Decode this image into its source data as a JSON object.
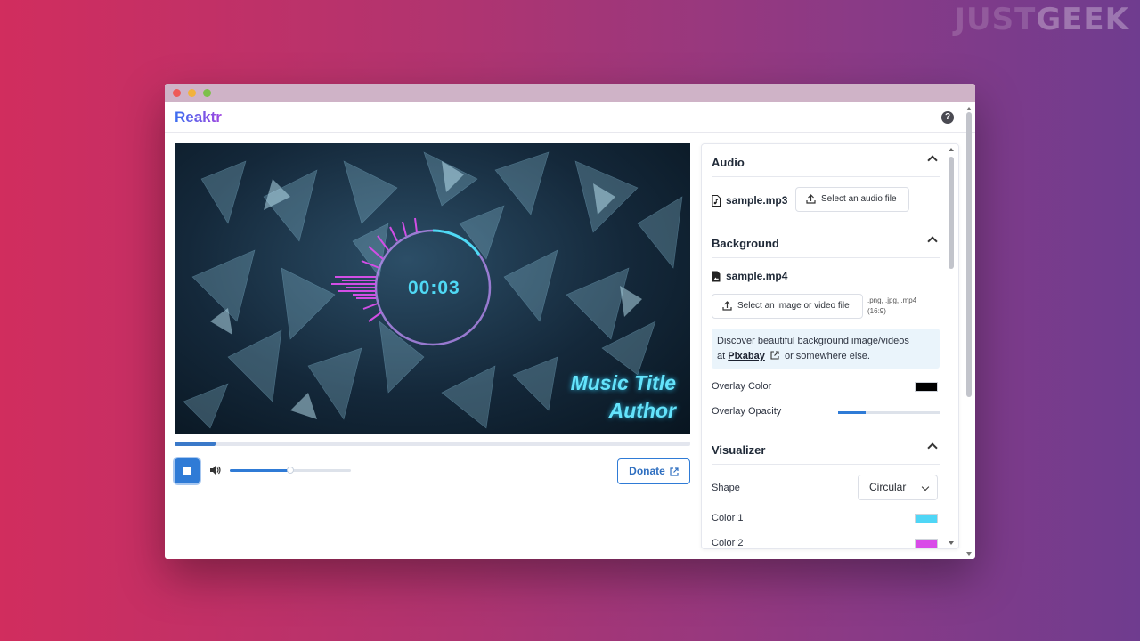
{
  "watermark": {
    "part1": "JUST",
    "part2": "GEEK"
  },
  "app": {
    "title": "Reaktr",
    "help_icon": "question-circle-icon"
  },
  "video": {
    "timer": "00:03",
    "song_title": "Music Title",
    "song_author": "Author",
    "progress_fraction": 0.08
  },
  "controls": {
    "stop_icon": "stop-icon",
    "volume_icon": "volume-icon",
    "volume_fraction": 0.5,
    "donate_label": "Donate",
    "donate_icon": "external-link-icon"
  },
  "panel": {
    "audio": {
      "title": "Audio",
      "file_name": "sample.mp3",
      "file_icon": "music-file-icon",
      "button_label": "Select an audio file"
    },
    "background": {
      "title": "Background",
      "file_name": "sample.mp4",
      "file_icon": "image-file-icon",
      "button_label": "Select an image or video file",
      "hint_line1": ".png, .jpg, .mp4",
      "hint_line2": "(16:9)",
      "info_text1": "Discover beautiful background image/videos",
      "info_at": "at",
      "info_link": "Pixabay",
      "info_text2": "or somewhere else.",
      "overlay_color_label": "Overlay Color",
      "overlay_color": "#000000",
      "overlay_opacity_label": "Overlay Opacity",
      "overlay_opacity_fraction": 0.27
    },
    "visualizer": {
      "title": "Visualizer",
      "shape_label": "Shape",
      "shape_value": "Circular",
      "color1_label": "Color 1",
      "color1": "#4fd6f6",
      "color2_label": "Color 2",
      "color2": "#d94ae8"
    }
  },
  "colors": {
    "accent": "#2f7bd6",
    "brand_start": "#3b6ff0",
    "brand_end": "#a047e0"
  }
}
